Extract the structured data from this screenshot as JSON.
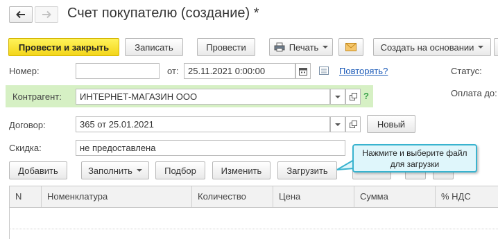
{
  "window": {
    "title": "Счет покупателю (создание) *"
  },
  "nav": {
    "back_icon": "arrow-left-icon",
    "forward_icon": "arrow-right-icon"
  },
  "toolbar": {
    "post_close": "Провести и закрыть",
    "save": "Записать",
    "post": "Провести",
    "print": "Печать",
    "create_based_on": "Создать на основании",
    "accent_color": "#f3d51a"
  },
  "form": {
    "number_label": "Номер:",
    "number_value": "",
    "date_from_label": "от:",
    "date_value": "25.11.2021  0:00:00",
    "repeat_link": "Повторять?",
    "status_label": "Статус:",
    "payment_label": "Оплата до:",
    "contractor_label": "Контрагент:",
    "contractor_value": "ИНТЕРНЕТ-МАГАЗИН ООО",
    "contractor_help": "?",
    "contract_label": "Договор:",
    "contract_value": "365 от 25.01.2021",
    "new_button": "Новый",
    "discount_label": "Скидка:",
    "discount_value": "не предоставлена"
  },
  "table_toolbar": {
    "add": "Добавить",
    "fill": "Заполнить",
    "select": "Подбор",
    "change": "Изменить",
    "load": "Загрузить"
  },
  "tooltip": {
    "text_line1": "Нажмите и выберите файл",
    "text_line2": "для загрузки"
  },
  "table": {
    "columns": [
      "N",
      "Номенклатура",
      "Количество",
      "Цена",
      "Сумма",
      "% НДС"
    ],
    "rows": []
  }
}
